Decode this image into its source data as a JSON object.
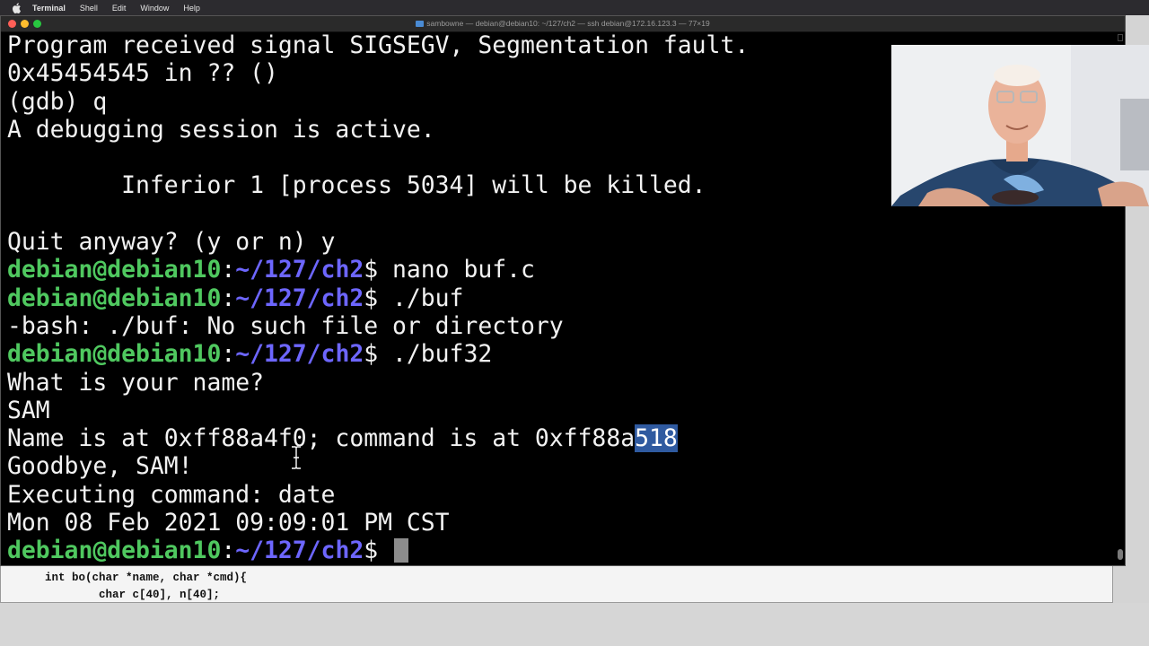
{
  "menubar": {
    "apple_icon": "apple-logo-icon",
    "items": [
      "Terminal",
      "Shell",
      "Edit",
      "Window",
      "Help"
    ]
  },
  "terminal": {
    "title": "sambowne — debian@debian10: ~/127/ch2 — ssh debian@172.16.123.3 — 77×19",
    "lines": {
      "l1": "Program received signal SIGSEGV, Segmentation fault.",
      "l2": "0x45454545 in ?? ()",
      "l3": "(gdb) q",
      "l4": "A debugging session is active.",
      "l5": "",
      "l6": "        Inferior 1 [process 5034] will be killed.",
      "l7": "",
      "l8": "Quit anyway? (y or n) y",
      "l9_cmd": " nano buf.c",
      "l10_cmd": " ./buf",
      "l11": "-bash: ./buf: No such file or directory",
      "l12_cmd": " ./buf32",
      "l13": "What is your name?",
      "l14": "SAM",
      "l15_a": "Name is at 0xff88a4f0; command is at 0xff88a",
      "l15_sel": "518",
      "l16": "Goodbye, SAM!",
      "l17": "Executing command: date",
      "l18": "Mon 08 Feb 2021 09:09:01 PM CST",
      "l19_cmd": " "
    },
    "prompt": {
      "user_host": "debian@debian10",
      "colon": ":",
      "path": "~/127/ch2",
      "dollar": "$"
    },
    "colors": {
      "background": "#000000",
      "text": "#f2f2f2",
      "prompt_user": "#4fc85f",
      "prompt_path": "#6d66ff",
      "selection": "#2f5aa0"
    }
  },
  "background_window": {
    "code_line1": "int bo(char *name, char *cmd){",
    "code_line2": "        char c[40], n[40];"
  },
  "overlay": {
    "webcam": "presenter webcam video"
  }
}
